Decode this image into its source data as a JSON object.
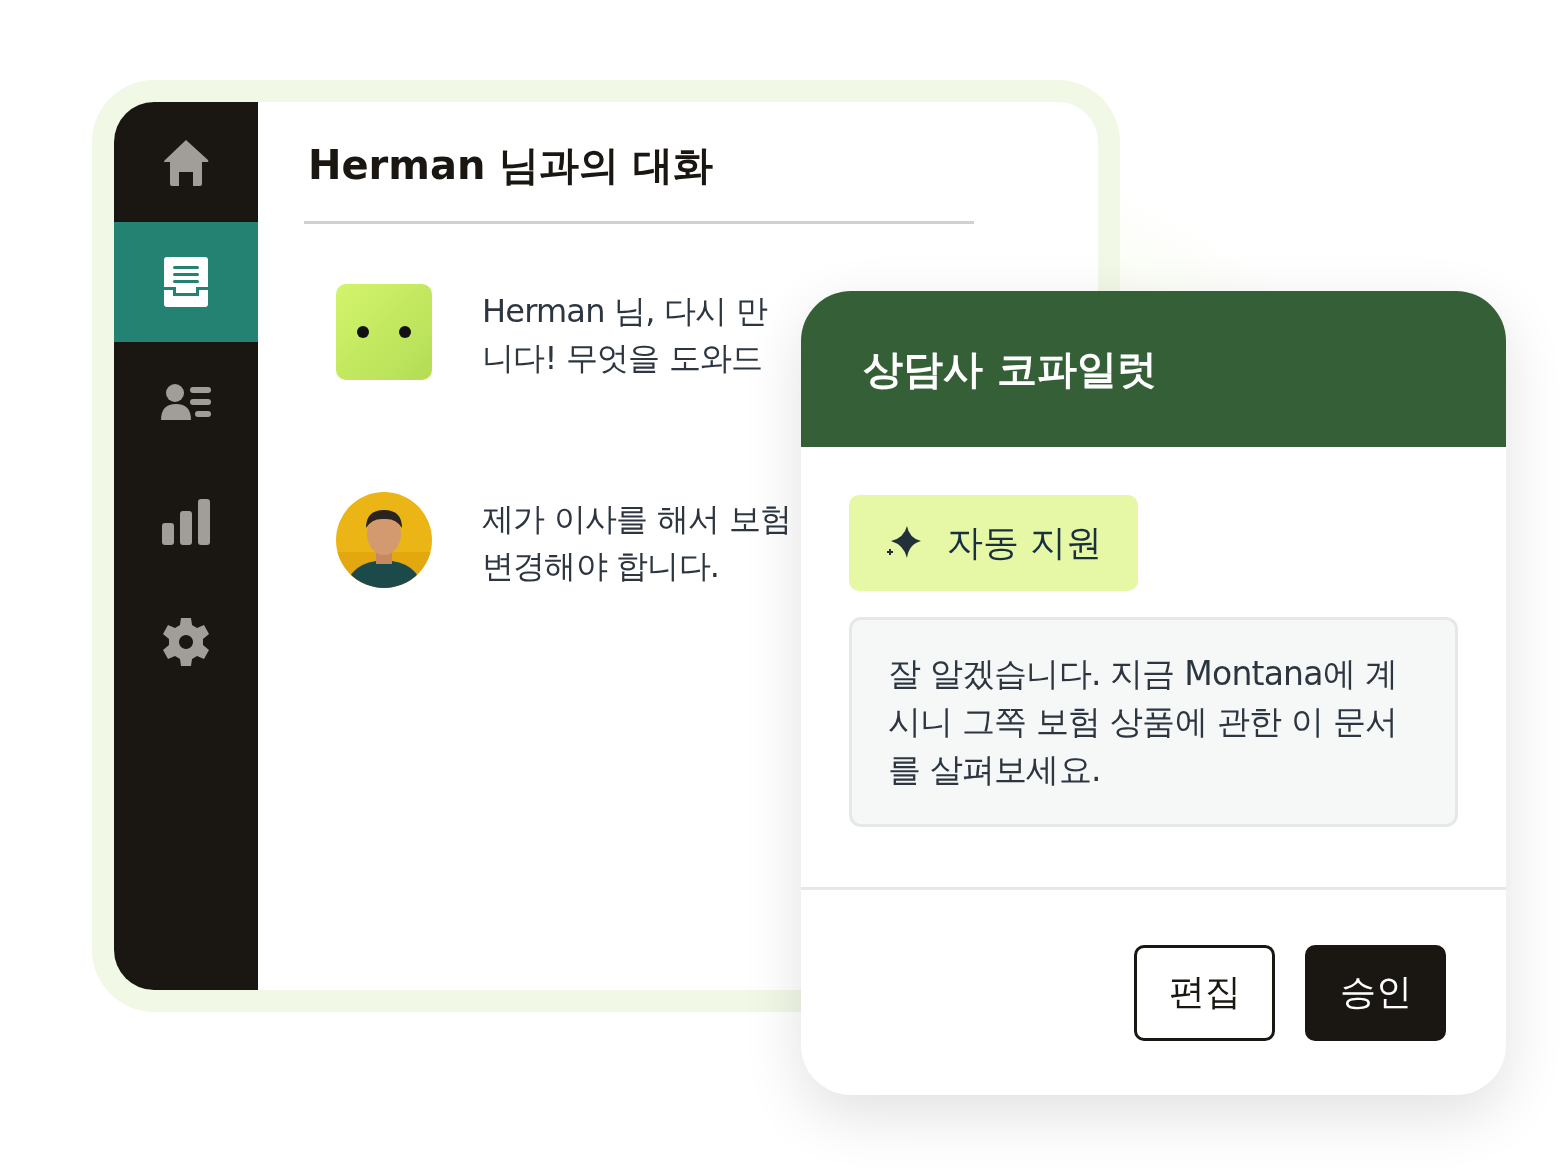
{
  "sidebar": {
    "items": [
      {
        "kind": "home",
        "selected": false
      },
      {
        "kind": "inbox",
        "selected": true
      },
      {
        "kind": "contacts",
        "selected": false
      },
      {
        "kind": "reports",
        "selected": false
      },
      {
        "kind": "settings",
        "selected": false
      }
    ]
  },
  "conversation": {
    "title": "Herman 님과의 대화",
    "messages": [
      {
        "kind": "bot",
        "lines": [
          "Herman 님, 다시 만",
          "니다! 무엇을 도와드"
        ]
      },
      {
        "kind": "user",
        "lines": [
          "제가 이사를 해서 보험",
          "변경해야 합니다."
        ]
      }
    ]
  },
  "copilot": {
    "title": "상담사 코파일럿",
    "assist_button": "자동 지원",
    "suggestion": "잘 알겠습니다. 지금 Montana에 계시니 그쪽 보험 상품에 관한 이 문서를 살펴보세요.",
    "buttons": [
      {
        "kind": "secondary",
        "label": "편집"
      },
      {
        "kind": "primary",
        "label": "승인"
      }
    ]
  }
}
